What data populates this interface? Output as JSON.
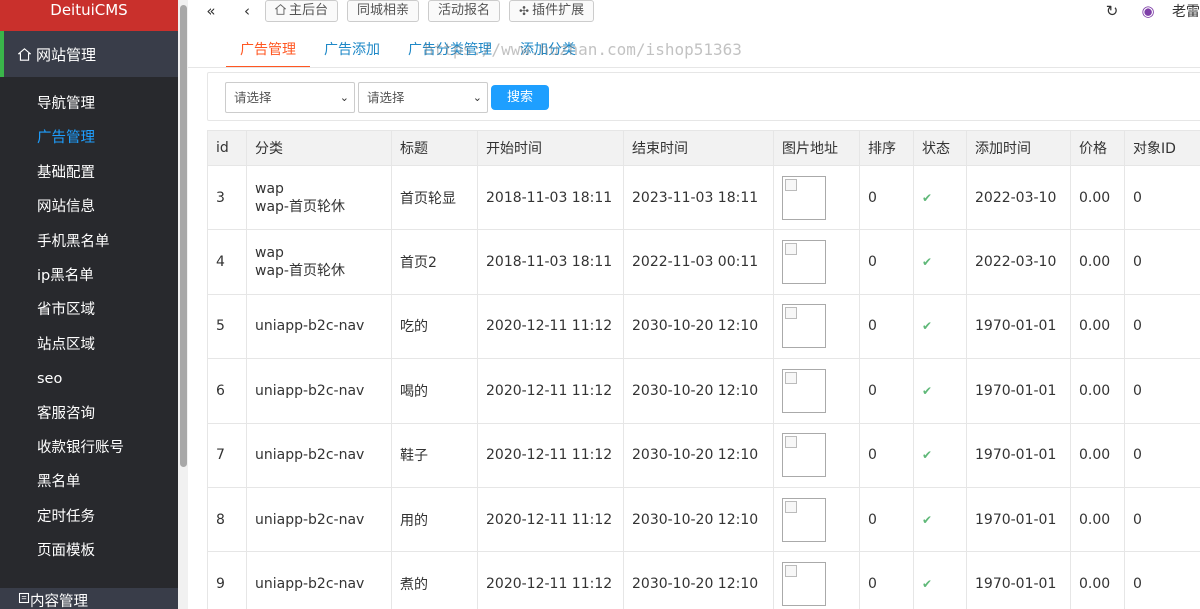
{
  "brand": "DeituiCMS",
  "sidebar": {
    "group_title": "网站管理",
    "items": [
      {
        "label": "导航管理",
        "active": false
      },
      {
        "label": "广告管理",
        "active": true
      },
      {
        "label": "基础配置",
        "active": false
      },
      {
        "label": "网站信息",
        "active": false
      },
      {
        "label": "手机黑名单",
        "active": false
      },
      {
        "label": "ip黑名单",
        "active": false
      },
      {
        "label": "省市区域",
        "active": false
      },
      {
        "label": "站点区域",
        "active": false
      },
      {
        "label": "seo",
        "active": false
      },
      {
        "label": "客服咨询",
        "active": false
      },
      {
        "label": "收款银行账号",
        "active": false
      },
      {
        "label": "黑名单",
        "active": false
      },
      {
        "label": "定时任务",
        "active": false
      },
      {
        "label": "页面模板",
        "active": false
      }
    ],
    "footer_group": "内容管理"
  },
  "topbar": {
    "btn_home": "主后台",
    "btn_dating": "同城相亲",
    "btn_event": "活动报名",
    "btn_plugin": "插件扩展",
    "user": "老雷"
  },
  "tabs": [
    "广告管理",
    "广告添加",
    "广告分类管理",
    "添加分类"
  ],
  "watermark": "https://www.huzhan.com/ishop51363",
  "filter": {
    "select1": "请选择",
    "select2": "请选择",
    "search_label": "搜索"
  },
  "table": {
    "headers": [
      "id",
      "分类",
      "标题",
      "开始时间",
      "结束时间",
      "图片地址",
      "排序",
      "状态",
      "添加时间",
      "价格",
      "对象ID"
    ],
    "rows": [
      {
        "id": "3",
        "cat1": "wap",
        "cat2": "wap-首页轮休",
        "title": "首页轮显",
        "start": "2018-11-03 18:11",
        "end": "2023-11-03 18:11",
        "sort": "0",
        "status": "✔",
        "added": "2022-03-10",
        "price": "0.00",
        "obj": "0"
      },
      {
        "id": "4",
        "cat1": "wap",
        "cat2": "wap-首页轮休",
        "title": "首页2",
        "start": "2018-11-03 18:11",
        "end": "2022-11-03 00:11",
        "sort": "0",
        "status": "✔",
        "added": "2022-03-10",
        "price": "0.00",
        "obj": "0"
      },
      {
        "id": "5",
        "cat1": "",
        "cat2": "uniapp-b2c-nav",
        "title": "吃的",
        "start": "2020-12-11 11:12",
        "end": "2030-10-20 12:10",
        "sort": "0",
        "status": "✔",
        "added": "1970-01-01",
        "price": "0.00",
        "obj": "0"
      },
      {
        "id": "6",
        "cat1": "",
        "cat2": "uniapp-b2c-nav",
        "title": "喝的",
        "start": "2020-12-11 11:12",
        "end": "2030-10-20 12:10",
        "sort": "0",
        "status": "✔",
        "added": "1970-01-01",
        "price": "0.00",
        "obj": "0"
      },
      {
        "id": "7",
        "cat1": "",
        "cat2": "uniapp-b2c-nav",
        "title": "鞋子",
        "start": "2020-12-11 11:12",
        "end": "2030-10-20 12:10",
        "sort": "0",
        "status": "✔",
        "added": "1970-01-01",
        "price": "0.00",
        "obj": "0"
      },
      {
        "id": "8",
        "cat1": "",
        "cat2": "uniapp-b2c-nav",
        "title": "用的",
        "start": "2020-12-11 11:12",
        "end": "2030-10-20 12:10",
        "sort": "0",
        "status": "✔",
        "added": "1970-01-01",
        "price": "0.00",
        "obj": "0"
      },
      {
        "id": "9",
        "cat1": "",
        "cat2": "uniapp-b2c-nav",
        "title": "煮的",
        "start": "2020-12-11 11:12",
        "end": "2030-10-20 12:10",
        "sort": "0",
        "status": "✔",
        "added": "1970-01-01",
        "price": "0.00",
        "obj": "0"
      }
    ]
  },
  "colors": {
    "brand_red": "#c9302c",
    "sidebar_bg": "#28292d",
    "active_blue": "#1e9fff",
    "tab_active": "#ff5722",
    "check_green": "#5fb878"
  },
  "icons": {
    "collapse": "double-chevron-left-icon",
    "back": "chevron-left-icon",
    "home": "home-icon",
    "plugin": "puzzle-icon",
    "refresh": "refresh-icon",
    "theme": "theme-icon",
    "site": "home-icon",
    "content": "document-icon"
  }
}
